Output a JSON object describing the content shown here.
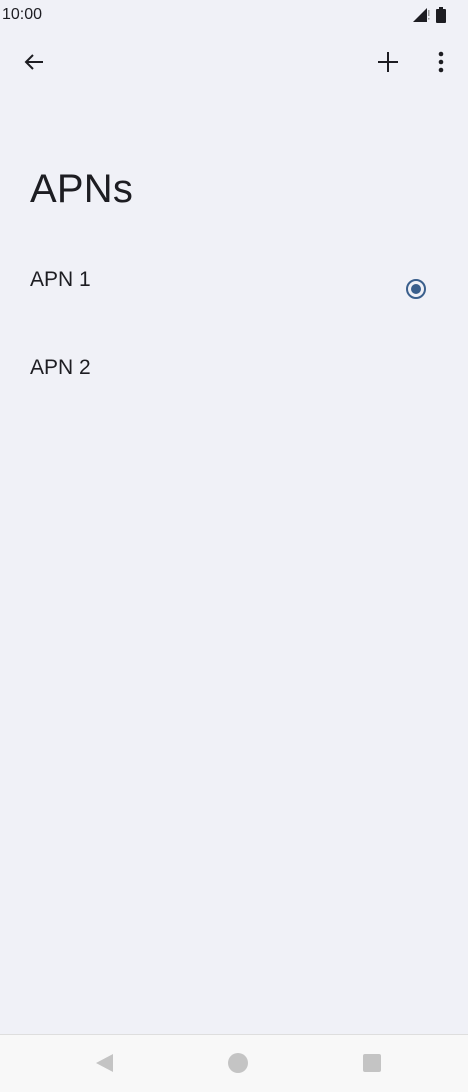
{
  "status_bar": {
    "time": "10:00",
    "icons": [
      "signal-icon",
      "battery-icon"
    ]
  },
  "toolbar": {
    "back_icon": "arrow-left-icon",
    "add_icon": "plus-icon",
    "more_icon": "more-vertical-icon"
  },
  "page": {
    "title": "APNs"
  },
  "apns": [
    {
      "name": "APN 1",
      "selected": true
    },
    {
      "name": "APN 2",
      "selected": false
    }
  ],
  "nav_bar": {
    "icons": [
      "nav-back-icon",
      "nav-home-icon",
      "nav-recents-icon"
    ]
  },
  "colors": {
    "background": "#f0f1f7",
    "accent": "#3a5f8c",
    "text": "#1d1d22",
    "nav_icon": "#c4c4c4"
  }
}
